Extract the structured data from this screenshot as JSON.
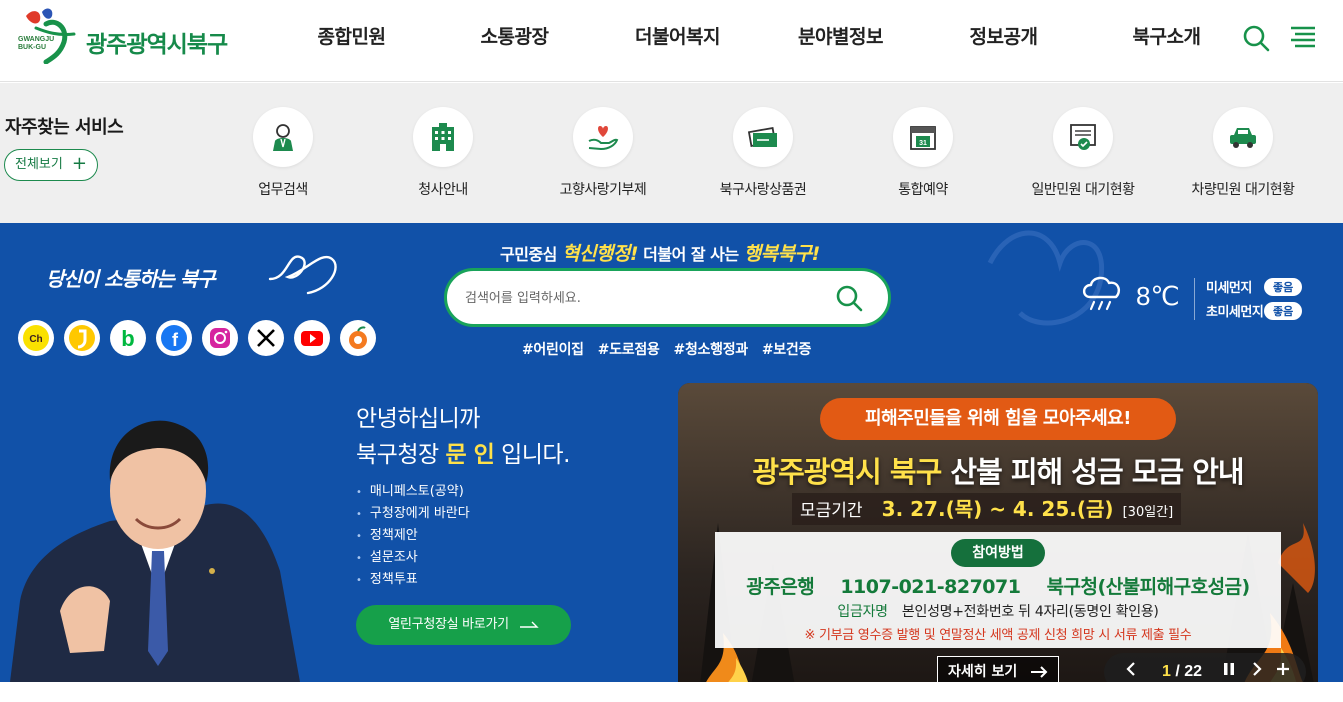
{
  "header": {
    "logo_en_line1": "GWANGJU",
    "logo_en_line2": "BUK-GU",
    "logo_title": "광주광역시북구",
    "nav": [
      "종합민원",
      "소통광장",
      "더불어복지",
      "분야별정보",
      "정보공개",
      "북구소개"
    ],
    "icons": [
      "search-icon",
      "menu-icon"
    ]
  },
  "quick": {
    "title": "자주찾는 서비스",
    "all_label": "전체보기",
    "all_plus": "+",
    "items": [
      {
        "label": "업무검색",
        "icon": "person-icon"
      },
      {
        "label": "청사안내",
        "icon": "building-icon"
      },
      {
        "label": "고향사랑기부제",
        "icon": "heart-hand-icon"
      },
      {
        "label": "북구사랑상품권",
        "icon": "voucher-icon"
      },
      {
        "label": "통합예약",
        "icon": "calendar-icon"
      },
      {
        "label": "일반민원 대기현황",
        "icon": "document-check-icon"
      },
      {
        "label": "차량민원 대기현황",
        "icon": "car-icon"
      }
    ]
  },
  "band": {
    "slogan": "당신이 소통하는 북구",
    "sns": [
      {
        "name": "kakao-channel",
        "glyph": "Ch",
        "bg": "#fae100",
        "fg": "#3c1e1e"
      },
      {
        "name": "kakao-story",
        "glyph": "❜",
        "bg": "#ffc800",
        "fg": "#ffffff"
      },
      {
        "name": "band",
        "glyph": "b",
        "bg": "#ffffff",
        "fg": "#00b83f"
      },
      {
        "name": "facebook",
        "glyph": "f",
        "bg": "#1877f2",
        "fg": "#ffffff"
      },
      {
        "name": "instagram",
        "glyph": "◎",
        "bg": "#d6249f",
        "fg": "#ffffff"
      },
      {
        "name": "x",
        "glyph": "X",
        "bg": "#ffffff",
        "fg": "#000000"
      },
      {
        "name": "youtube",
        "glyph": "▶",
        "bg": "#ffffff",
        "fg": "#ff0000"
      },
      {
        "name": "tangerine",
        "glyph": "●",
        "bg": "#ffffff",
        "fg": "#f47a20"
      }
    ],
    "tagline_pre": "구민중심",
    "tagline_em1": "혁신행정!",
    "tagline_mid": "더불어 잘 사는",
    "tagline_em2": "행복북구!",
    "search_placeholder": "검색어를 입력하세요.",
    "tags": [
      "#어린이집",
      "#도로점용",
      "#청소행정과",
      "#보건증"
    ],
    "weather": {
      "temp": "8℃",
      "dust_fine_label": "미세먼지",
      "dust_fine_value": "좋음",
      "dust_ultra_label": "초미세먼지",
      "dust_ultra_value": "좋음"
    }
  },
  "mayor": {
    "greet1": "안녕하십니까",
    "greet2_pre": "북구청장",
    "greet2_name": "문 인",
    "greet2_post": "입니다.",
    "links": [
      "매니페스토(공약)",
      "구청장에게 바란다",
      "정책제안",
      "설문조사",
      "정책투표"
    ],
    "button": "열린구청장실 바로가기"
  },
  "banner": {
    "pill": "피해주민들을 위해 힘을 모아주세요!",
    "title_em": "광주광역시 북구",
    "title_rest": "산불 피해 성금 모금 안내",
    "period_label": "모금기간",
    "period_value": "3. 27.(목) ~ 4. 25.(금)",
    "period_days": "[30일간]",
    "join_badge": "참여방법",
    "bank": "광주은행",
    "account_no": "1107-021-827071",
    "account_holder": "북구청(산불피해구호성금)",
    "name_label": "입금자명",
    "name_rule": "본인성명+전화번호 뒤 4자리(동명인 확인용)",
    "note": "※ 기부금 영수증 발행 및 연말정산 세액 공제 신청 희망 시 서류 제출 필수",
    "more": "자세히 보기",
    "page_current": "1",
    "page_total": "/ 22"
  }
}
